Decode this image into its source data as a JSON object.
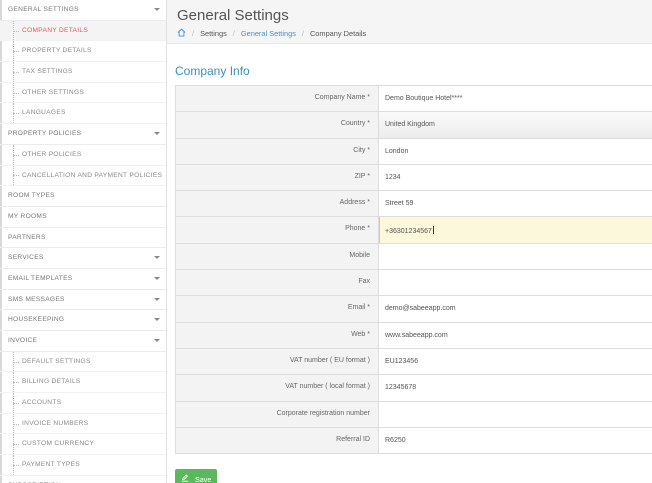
{
  "sidebar": {
    "items": [
      {
        "label": "GENERAL SETTINGS",
        "sub": false,
        "caret": true,
        "active": false
      },
      {
        "label": "COMPANY DETAILS",
        "sub": true,
        "caret": false,
        "active": true
      },
      {
        "label": "PROPERTY DETAILS",
        "sub": true,
        "caret": false,
        "active": false
      },
      {
        "label": "TAX SETTINGS",
        "sub": true,
        "caret": false,
        "active": false
      },
      {
        "label": "OTHER SETTINGS",
        "sub": true,
        "caret": false,
        "active": false
      },
      {
        "label": "LANGUAGES",
        "sub": true,
        "caret": false,
        "active": false
      },
      {
        "label": "PROPERTY POLICIES",
        "sub": false,
        "caret": true,
        "active": false
      },
      {
        "label": "OTHER POLICIES",
        "sub": true,
        "caret": false,
        "active": false
      },
      {
        "label": "CANCELLATION AND PAYMENT POLICIES",
        "sub": true,
        "caret": false,
        "active": false
      },
      {
        "label": "ROOM TYPES",
        "sub": false,
        "caret": false,
        "active": false
      },
      {
        "label": "MY ROOMS",
        "sub": false,
        "caret": false,
        "active": false
      },
      {
        "label": "PARTNERS",
        "sub": false,
        "caret": false,
        "active": false
      },
      {
        "label": "SERVICES",
        "sub": false,
        "caret": true,
        "active": false
      },
      {
        "label": "EMAIL TEMPLATES",
        "sub": false,
        "caret": true,
        "active": false
      },
      {
        "label": "SMS MESSAGES",
        "sub": false,
        "caret": true,
        "active": false
      },
      {
        "label": "HOUSEKEEPING",
        "sub": false,
        "caret": true,
        "active": false
      },
      {
        "label": "INVOICE",
        "sub": false,
        "caret": true,
        "active": false
      },
      {
        "label": "DEFAULT SETTINGS",
        "sub": true,
        "caret": false,
        "active": false
      },
      {
        "label": "BILLING DETAILS",
        "sub": true,
        "caret": false,
        "active": false
      },
      {
        "label": "ACCOUNTS",
        "sub": true,
        "caret": false,
        "active": false
      },
      {
        "label": "INVOICE NUMBERS",
        "sub": true,
        "caret": false,
        "active": false
      },
      {
        "label": "CUSTOM CURRENCY",
        "sub": true,
        "caret": false,
        "active": false
      },
      {
        "label": "PAYMENT TYPES",
        "sub": true,
        "caret": false,
        "active": false
      },
      {
        "label": "SUBSCRIPTION",
        "sub": false,
        "caret": false,
        "active": false
      }
    ],
    "colors": {
      "active_text": "#e05a5a",
      "caret": "#888888"
    }
  },
  "header": {
    "title": "General Settings",
    "breadcrumb": {
      "home_icon": "home-icon",
      "settings": "Settings",
      "general_settings": "General Settings",
      "current": "Company Details"
    }
  },
  "section": {
    "title": "Company Info"
  },
  "form": {
    "company_name": {
      "label": "Company Name *",
      "value": "Demo Boutique Hotel****"
    },
    "country": {
      "label": "Country *",
      "value": "United Kingdom"
    },
    "city": {
      "label": "City *",
      "value": "London"
    },
    "zip": {
      "label": "ZIP *",
      "value": "1234"
    },
    "address": {
      "label": "Address *",
      "value": "Street 59"
    },
    "phone": {
      "label": "Phone *",
      "value": "+36301234567"
    },
    "mobile": {
      "label": "Mobile",
      "value": ""
    },
    "fax": {
      "label": "Fax",
      "value": ""
    },
    "email": {
      "label": "Email *",
      "value": "demo@sabeeapp.com"
    },
    "web": {
      "label": "Web *",
      "value": "www.sabeeapp.com"
    },
    "vat_eu": {
      "label": "VAT number ( EU format )",
      "value": "EU123456"
    },
    "vat_local": {
      "label": "VAT number ( local format )",
      "value": "12345678"
    },
    "corp_reg": {
      "label": "Corporate registration number",
      "value": ""
    },
    "referral": {
      "label": "Referral ID",
      "value": "R6250"
    }
  },
  "actions": {
    "save_label": "Save",
    "save_icon": "edit-icon",
    "save_color": "#5cb85c"
  },
  "colors": {
    "accent": "#3a8fc2",
    "link": "#4a90c2",
    "focus_bg": "#fbf8dc"
  }
}
